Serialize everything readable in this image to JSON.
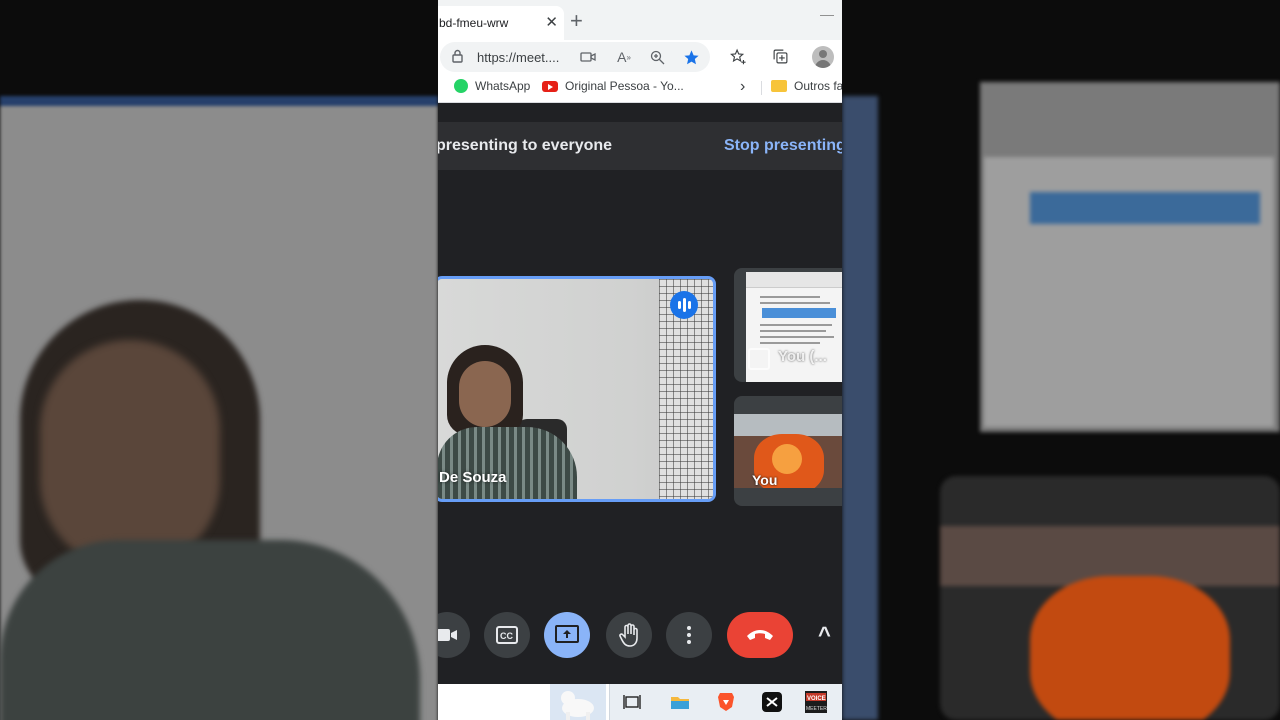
{
  "browser": {
    "tab_title": "bd-fmeu-wrw",
    "url": "https://meet....",
    "bookmarks": [
      {
        "label": "WhatsApp",
        "icon": "whatsapp-icon"
      },
      {
        "label": "Original Pessoa - Yo...",
        "icon": "youtube-icon"
      },
      {
        "label": "Outros fa",
        "icon": "folder-icon"
      }
    ]
  },
  "meet": {
    "presenting_banner": "presenting to everyone",
    "stop_presenting": "Stop presenting",
    "main_participant_name": "De Souza",
    "self_presentation_label": "You (...",
    "self_camera_label": "You",
    "colors": {
      "background": "#202124",
      "accent_blue": "#8ab4f8",
      "active_border": "#669df6",
      "hangup_red": "#ea4335"
    },
    "controls": [
      "camera-button",
      "captions-button",
      "present-button",
      "raise-hand-button",
      "more-options-button",
      "leave-call-button",
      "expand-button"
    ]
  }
}
